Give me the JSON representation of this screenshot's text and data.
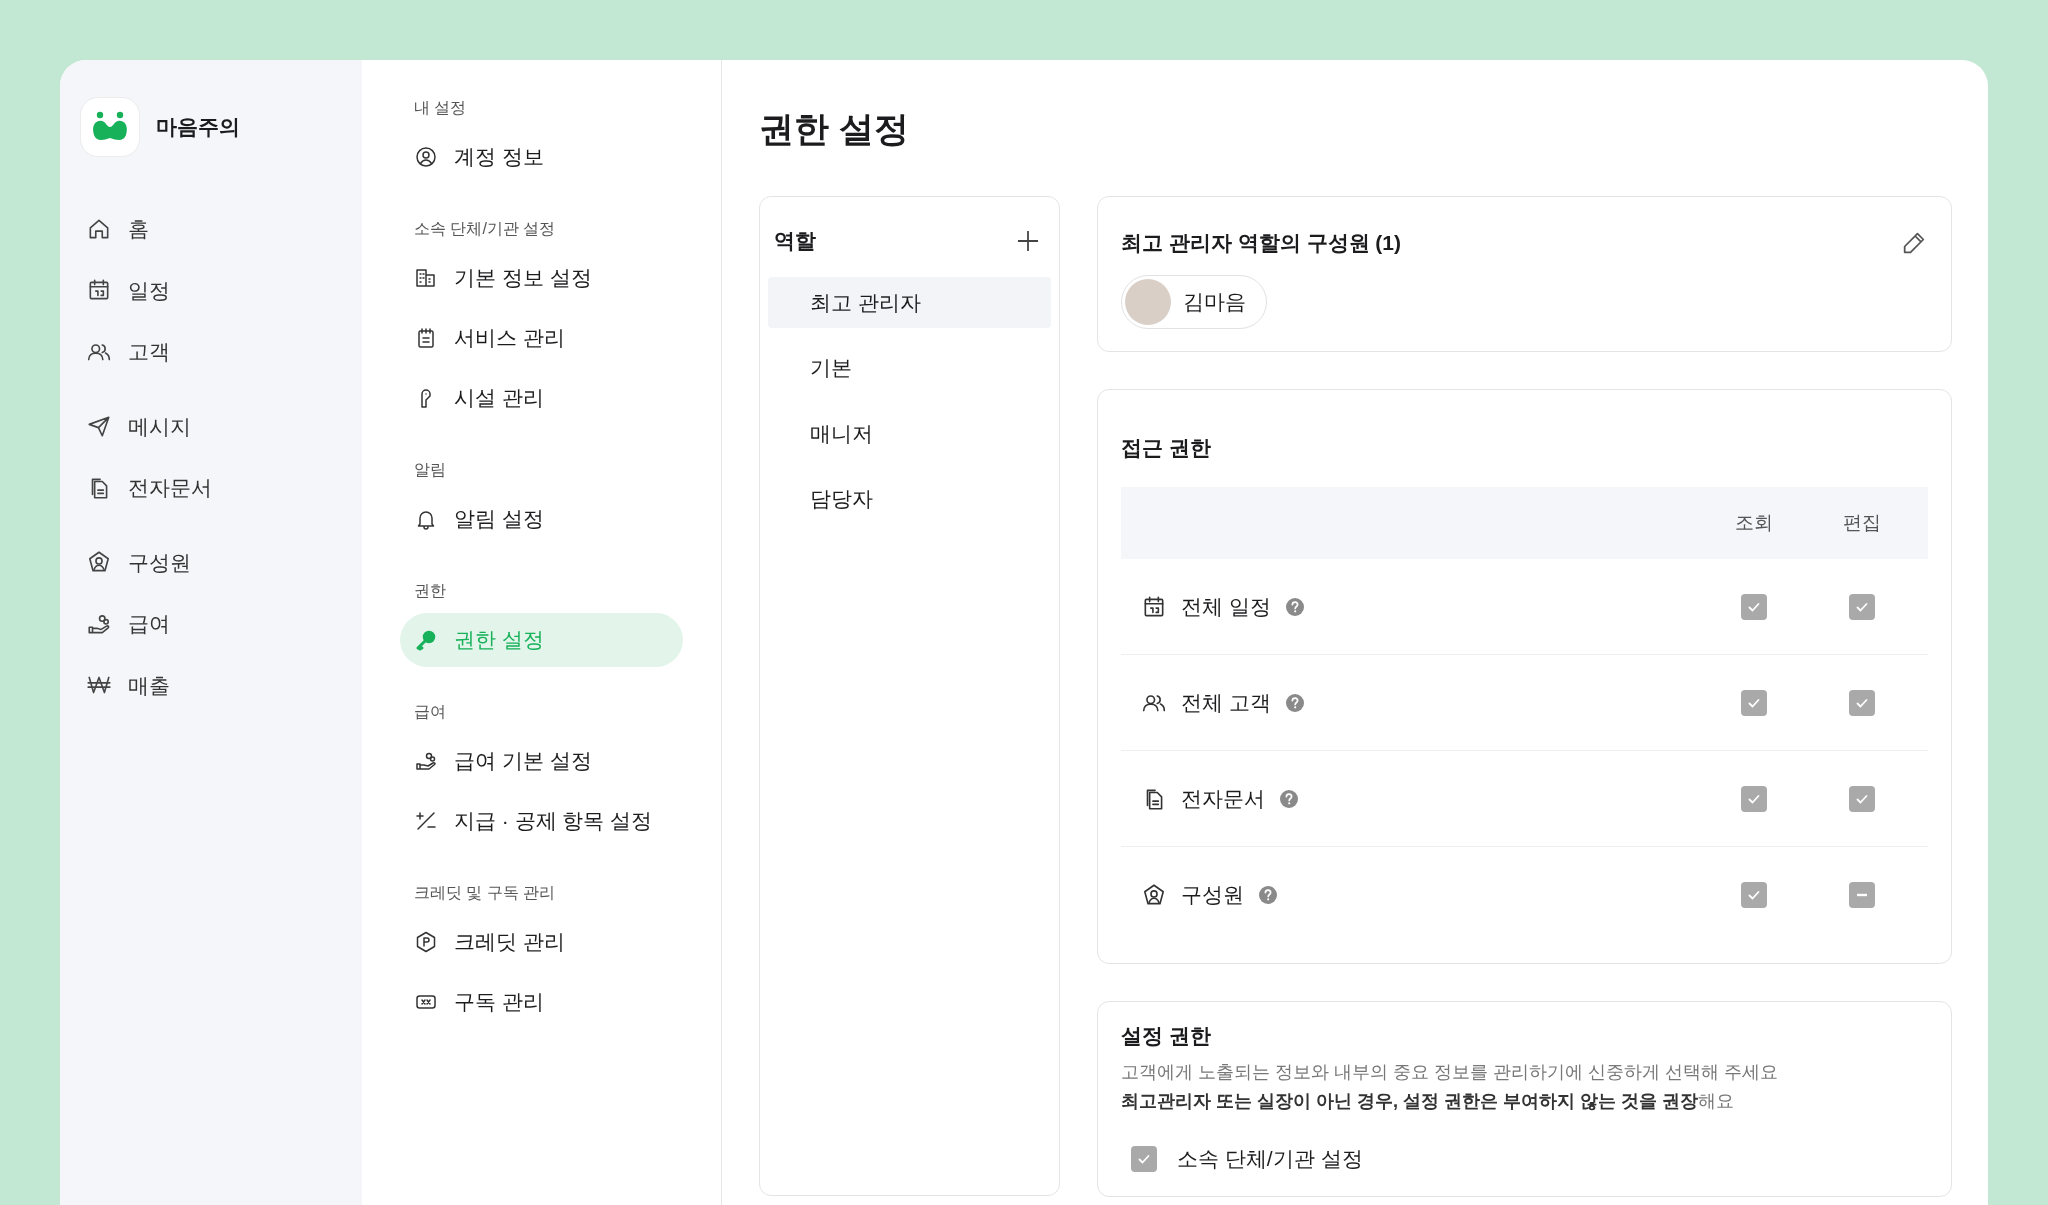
{
  "brand": {
    "name": "마음주의"
  },
  "nav_groups": [
    [
      {
        "label": "홈"
      },
      {
        "label": "일정"
      },
      {
        "label": "고객"
      }
    ],
    [
      {
        "label": "메시지"
      },
      {
        "label": "전자문서"
      }
    ],
    [
      {
        "label": "구성원"
      },
      {
        "label": "급여"
      },
      {
        "label": "매출"
      }
    ]
  ],
  "settings_menu": [
    {
      "heading": "내 설정",
      "items": [
        {
          "label": "계정 정보",
          "selected": false
        }
      ]
    },
    {
      "heading": "소속 단체/기관 설정",
      "items": [
        {
          "label": "기본 정보 설정",
          "selected": false
        },
        {
          "label": "서비스 관리",
          "selected": false
        },
        {
          "label": "시설 관리",
          "selected": false
        }
      ]
    },
    {
      "heading": "알림",
      "items": [
        {
          "label": "알림 설정",
          "selected": false
        }
      ]
    },
    {
      "heading": "권한",
      "items": [
        {
          "label": "권한 설정",
          "selected": true
        }
      ]
    },
    {
      "heading": "급여",
      "items": [
        {
          "label": "급여 기본 설정",
          "selected": false
        },
        {
          "label": "지급 · 공제 항목 설정",
          "selected": false
        }
      ]
    },
    {
      "heading": "크레딧 및 구독 관리",
      "items": [
        {
          "label": "크레딧 관리",
          "selected": false
        },
        {
          "label": "구독 관리",
          "selected": false
        }
      ]
    }
  ],
  "page_title": "권한 설정",
  "roles": {
    "title": "역할",
    "items": [
      {
        "label": "최고 관리자",
        "selected": true
      },
      {
        "label": "기본",
        "selected": false
      },
      {
        "label": "매니저",
        "selected": false
      },
      {
        "label": "담당자",
        "selected": false
      }
    ]
  },
  "members": {
    "title": "최고 관리자 역할의 구성원 (1)",
    "items": [
      {
        "name": "김마음"
      }
    ]
  },
  "access": {
    "title": "접근 권한",
    "columns": [
      "조회",
      "편집"
    ],
    "rows": [
      {
        "label": "전체 일정",
        "checks": [
          {
            "checked": true
          },
          {
            "checked": true
          }
        ]
      },
      {
        "label": "전체 고객",
        "checks": [
          {
            "checked": true
          },
          {
            "checked": true
          }
        ]
      },
      {
        "label": "전자문서",
        "checks": [
          {
            "checked": true
          },
          {
            "checked": true
          }
        ]
      },
      {
        "label": "구성원",
        "checks": [
          {
            "checked": true
          },
          {
            "checked": true,
            "indeterminate": true
          }
        ]
      }
    ]
  },
  "settings_perm": {
    "title": "설정 권한",
    "description": [
      "고객에게 노출되는 정보와 내부의 중요 정보를 관리하기에 신중하게 선택해 주세요",
      "**최고관리자 또는 실장이 아닌 경우, 설정 권한은 부여하지 않는 것을 권장**해요"
    ],
    "items": [
      {
        "label": "소속 단체/기관 설정",
        "checked": true
      }
    ]
  }
}
